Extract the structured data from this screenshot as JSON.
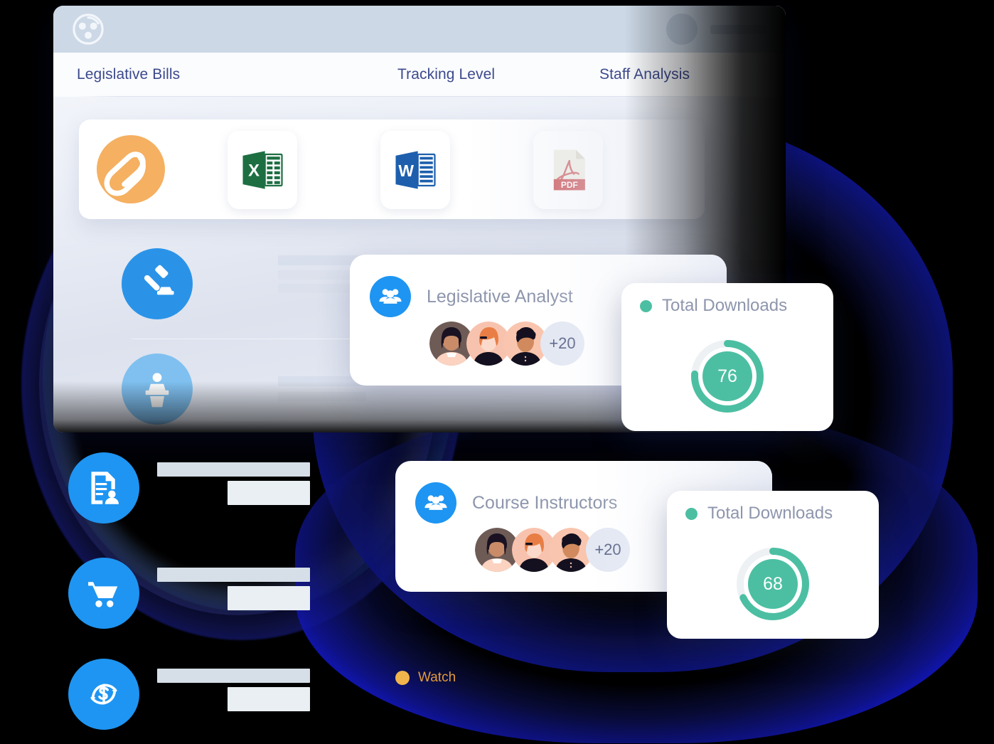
{
  "window": {
    "logo_icon": "collaboration-logo-icon",
    "account_avatar": "account-avatar-placeholder",
    "account_name_placeholder": "",
    "tabs": [
      {
        "id": "legislative-bills",
        "label": "Legislative Bills"
      },
      {
        "id": "tracking-level",
        "label": "Tracking Level"
      },
      {
        "id": "staff-analysis",
        "label": "Staff Analysis"
      }
    ]
  },
  "file_types": [
    {
      "id": "attachment",
      "icon": "paperclip-icon",
      "label": "",
      "color": "#F5B061"
    },
    {
      "id": "excel",
      "icon": "excel-file-icon",
      "label": "X",
      "color": "#1D6F42"
    },
    {
      "id": "word",
      "icon": "word-file-icon",
      "label": "W",
      "color": "#1D5FAD"
    },
    {
      "id": "pdf",
      "icon": "pdf-file-icon",
      "label": "PDF",
      "color": "#C8484B"
    }
  ],
  "window_rows": [
    {
      "id": "gavel-row",
      "icon": "gavel-icon",
      "color": "#2A93E8"
    },
    {
      "id": "podium-row",
      "icon": "podium-speaker-icon",
      "color": "#7FC0F0"
    }
  ],
  "list_rows": [
    {
      "id": "document-profile-row",
      "icon": "document-profile-icon",
      "color": "#1E95F2"
    },
    {
      "id": "cart-row",
      "icon": "shopping-cart-icon",
      "color": "#1E95F2"
    },
    {
      "id": "refund-row",
      "icon": "dollar-refresh-icon",
      "color": "#1E95F2"
    }
  ],
  "role_cards": [
    {
      "id": "legislative-analyst",
      "icon": "users-group-icon",
      "title": "Legislative Analyst",
      "more_count": "+20",
      "avatars": [
        "avatar-woman-dark-bob",
        "avatar-person-red-hair",
        "avatar-person-curly-hair"
      ]
    },
    {
      "id": "course-instructors",
      "icon": "users-group-icon",
      "title": "Course Instructors",
      "more_count": "+20",
      "avatars": [
        "avatar-woman-dark-bob",
        "avatar-person-red-hair",
        "avatar-person-curly-hair"
      ]
    }
  ],
  "stat_cards": [
    {
      "id": "total-downloads-76",
      "label": "Total Downloads",
      "value": "76",
      "accent": "#4CBFA2",
      "track": "#EDF1F3"
    },
    {
      "id": "total-downloads-68",
      "label": "Total Downloads",
      "value": "68",
      "accent": "#4CBFA2",
      "track": "#EDF1F3"
    }
  ],
  "watch": {
    "label": "Watch",
    "dot_color": "#F0B44C"
  }
}
